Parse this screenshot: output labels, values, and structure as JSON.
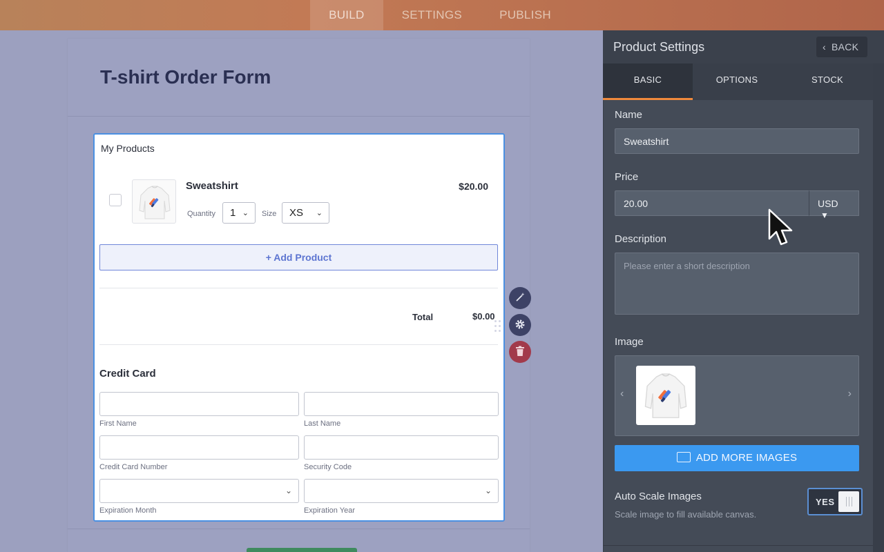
{
  "topbar": {
    "tabs": [
      "BUILD",
      "SETTINGS",
      "PUBLISH"
    ],
    "active": "BUILD"
  },
  "form": {
    "title": "T-shirt Order Form"
  },
  "widget": {
    "title": "My Products",
    "product": {
      "name": "Sweatshirt",
      "price": "$20.00",
      "quantity_label": "Quantity",
      "quantity_value": "1",
      "size_label": "Size",
      "size_value": "XS"
    },
    "add_product": "+ Add Product",
    "total_label": "Total",
    "total_value": "$0.00",
    "credit_card": {
      "title": "Credit Card",
      "fields": [
        "First Name",
        "Last Name",
        "Credit Card Number",
        "Security Code",
        "Expiration Month",
        "Expiration Year"
      ]
    }
  },
  "tools": {
    "wand_icon": "magic-wand-icon",
    "settings_icon": "gear-icon",
    "delete_icon": "trash-icon"
  },
  "panel": {
    "title": "Product Settings",
    "back": "BACK",
    "tabs": [
      "BASIC",
      "OPTIONS",
      "STOCK"
    ],
    "active_tab": "BASIC",
    "name_label": "Name",
    "name_value": "Sweatshirt",
    "price_label": "Price",
    "price_value": "20.00",
    "currency": "USD",
    "description_label": "Description",
    "description_placeholder": "Please enter a short description",
    "image_label": "Image",
    "add_images": "ADD MORE IMAGES",
    "auto_scale_label": "Auto Scale Images",
    "auto_scale_value": "YES",
    "auto_scale_hint": "Scale image to fill available canvas."
  },
  "colors": {
    "accent_orange": "#f08a3c",
    "primary_blue": "#3b99f0",
    "widget_border": "#4a90e2",
    "delete_red": "#a23a4b"
  }
}
